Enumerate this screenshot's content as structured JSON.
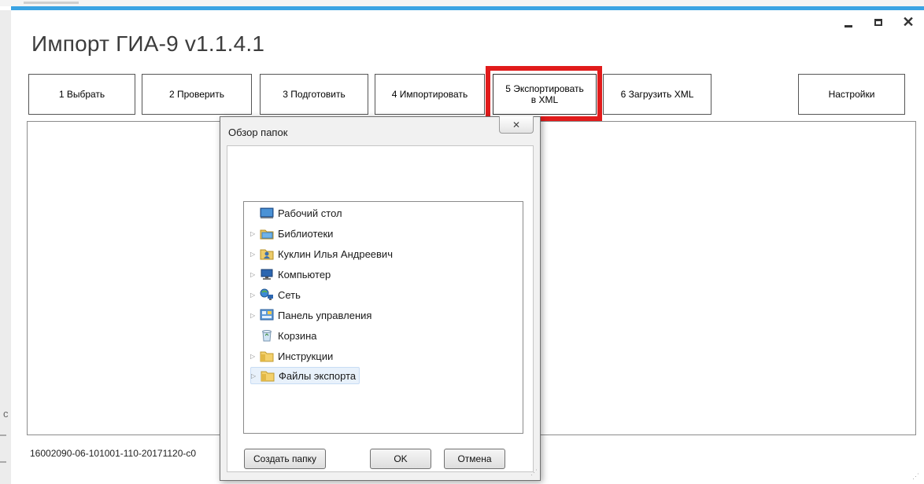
{
  "app": {
    "title": "Импорт ГИА-9 v1.1.4.1",
    "window_controls": {
      "minimize": "-",
      "maximize": "□",
      "close": "×"
    }
  },
  "toolbar": {
    "btn1": "1   Выбрать",
    "btn2": "2   Проверить",
    "btn3": "3  Подготовить",
    "btn4": "4 Импортировать",
    "btn5": "5 Экспортировать в XML",
    "btn6": "6 Загрузить XML",
    "settings": "Настройки",
    "highlight_color": "#e11b1b"
  },
  "status": {
    "text": "16002090-06-101001-110-20171120-c0"
  },
  "dialog": {
    "title": "Обзор папок",
    "close_glyph": "✕",
    "tree": [
      {
        "label": "Рабочий стол",
        "icon": "desktop-icon",
        "expandable": false
      },
      {
        "label": "Библиотеки",
        "icon": "libraries-icon",
        "expandable": true
      },
      {
        "label": "Куклин Илья Андреевич",
        "icon": "user-folder-icon",
        "expandable": true
      },
      {
        "label": "Компьютер",
        "icon": "computer-icon",
        "expandable": true
      },
      {
        "label": "Сеть",
        "icon": "network-icon",
        "expandable": true
      },
      {
        "label": "Панель управления",
        "icon": "control-panel-icon",
        "expandable": true
      },
      {
        "label": "Корзина",
        "icon": "recycle-bin-icon",
        "expandable": false
      },
      {
        "label": "Инструкции",
        "icon": "folder-icon",
        "expandable": true
      },
      {
        "label": "Файлы экспорта",
        "icon": "folder-icon",
        "expandable": true,
        "selected": true
      }
    ],
    "new_folder": "Создать папку",
    "ok": "OK",
    "cancel": "Отмена"
  },
  "colors": {
    "accent": "#3aa3e3",
    "selection": "#e8f1fb"
  }
}
